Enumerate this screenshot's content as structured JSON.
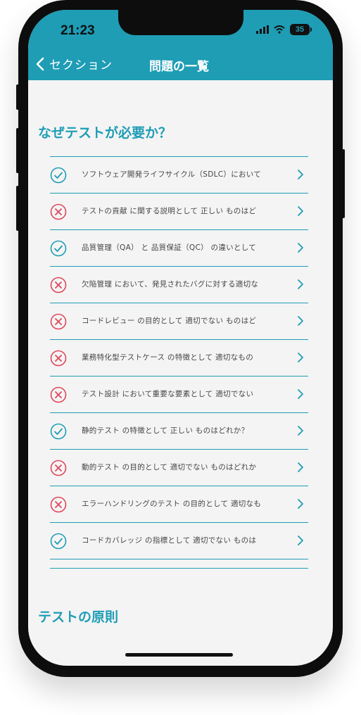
{
  "status_bar": {
    "time": "21:23",
    "battery": "35"
  },
  "nav": {
    "back_label": "セクション",
    "title": "問題の一覧"
  },
  "sections": [
    {
      "title": "なぜテストが必要か？"
    },
    {
      "title": "テストの原則"
    }
  ],
  "questions": [
    {
      "text": "ソフトウェア開発ライフサイクル（SDLC）において",
      "status": "correct"
    },
    {
      "text": "テストの貢献 に関する説明として 正しい ものはど",
      "status": "incorrect"
    },
    {
      "text": "品質管理（QA） と 品質保証（QC） の違いとして",
      "status": "correct"
    },
    {
      "text": "欠陥管理 において、発見されたバグに対する適切な",
      "status": "incorrect"
    },
    {
      "text": "コードレビュー の目的として 適切でない ものはど",
      "status": "incorrect"
    },
    {
      "text": "業務特化型テストケース の特徴として 適切なもの",
      "status": "incorrect"
    },
    {
      "text": "テスト設計 において重要な要素として 適切でない",
      "status": "incorrect"
    },
    {
      "text": "静的テスト の特徴として 正しい ものはどれか？",
      "status": "correct"
    },
    {
      "text": "動的テスト の目的として 適切でない ものはどれか",
      "status": "incorrect"
    },
    {
      "text": "エラーハンドリングのテスト の目的として 適切なも",
      "status": "incorrect"
    },
    {
      "text": "コードカバレッジ の指標として 適切でない ものは",
      "status": "correct"
    }
  ],
  "icons": {
    "correct": "check-circle-icon",
    "incorrect": "x-circle-icon",
    "chevron": "chevron-right-icon",
    "back": "chevron-left-icon"
  },
  "colors": {
    "accent": "#1e9db5",
    "correct": "#1e9db5",
    "incorrect": "#e0475a",
    "background": "#f4f4f4"
  }
}
